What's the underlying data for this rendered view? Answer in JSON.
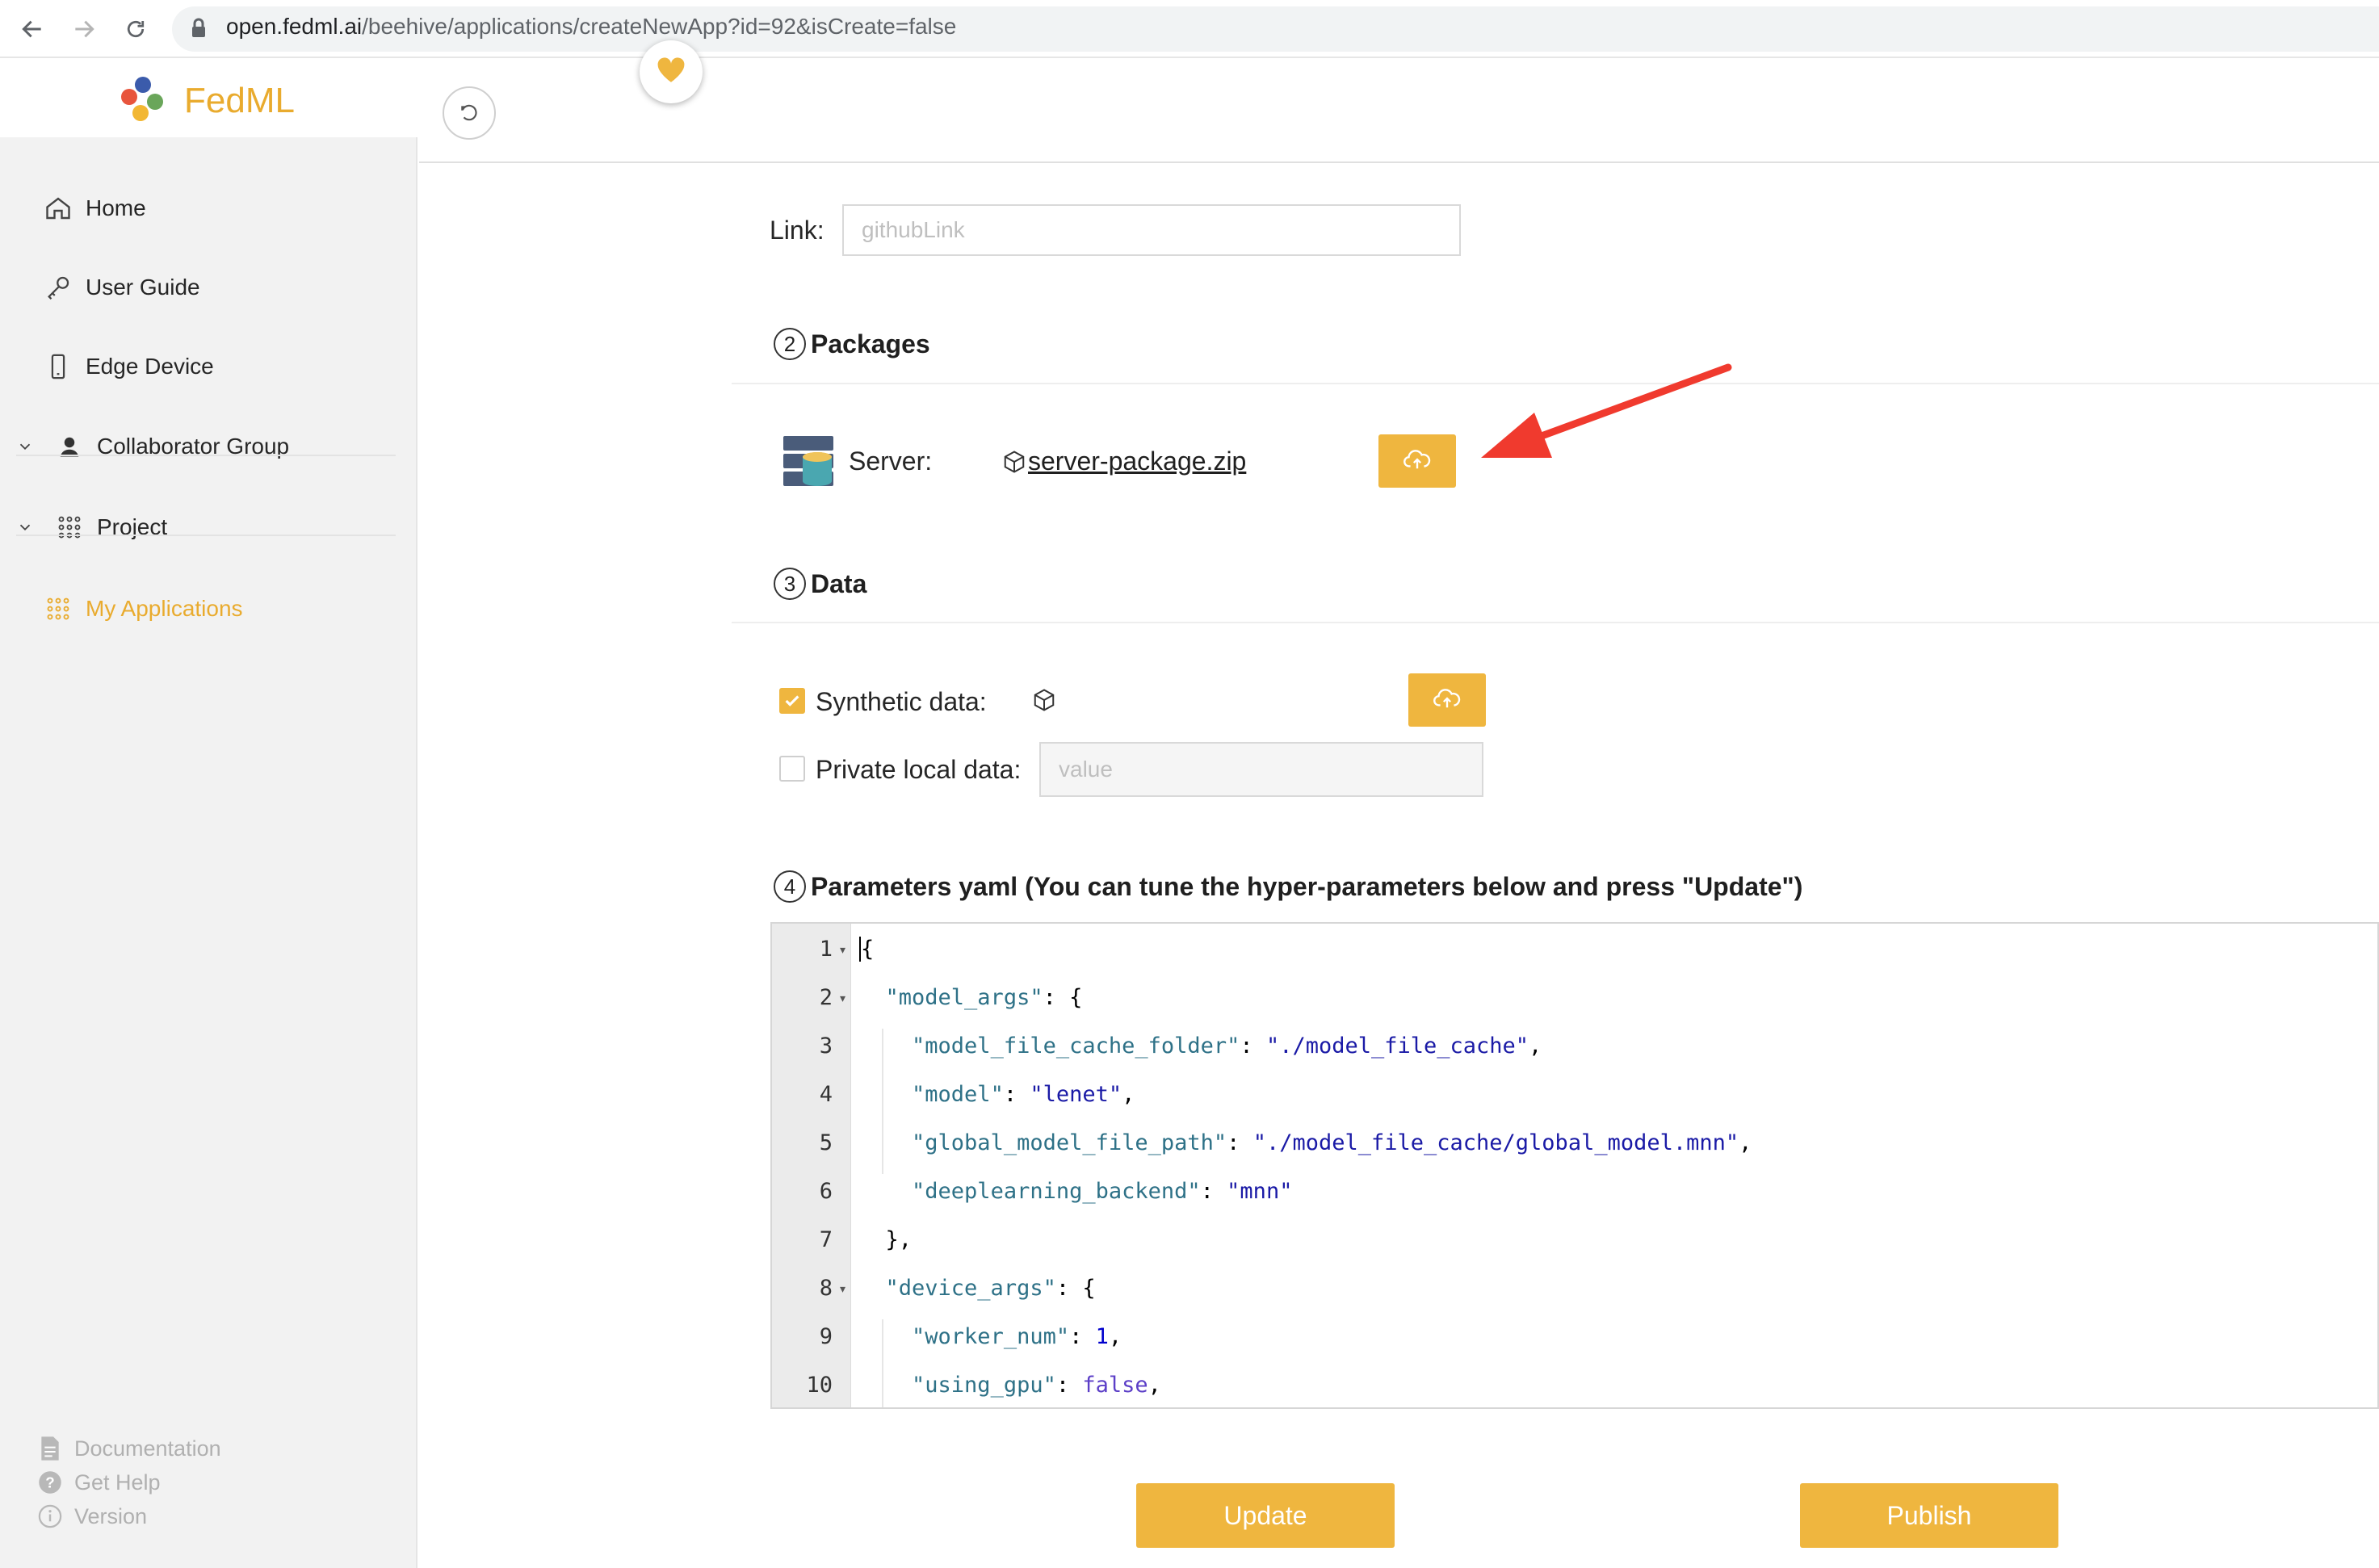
{
  "browser": {
    "url_host": "open.fedml.ai",
    "url_path": "/beehive/applications/createNewApp?id=92&isCreate=false"
  },
  "sidebar": {
    "brand": "FedML",
    "items": [
      {
        "label": "Home",
        "icon": "home-icon"
      },
      {
        "label": "User Guide",
        "icon": "key-icon"
      },
      {
        "label": "Edge Device",
        "icon": "phone-icon"
      },
      {
        "label": "Collaborator Group",
        "icon": "user-icon"
      },
      {
        "label": "Project",
        "icon": "apps-icon"
      },
      {
        "label": "My Applications",
        "icon": "apps-icon"
      }
    ],
    "footer": [
      {
        "label": "Documentation",
        "icon": "document-icon"
      },
      {
        "label": "Get Help",
        "icon": "help-icon"
      },
      {
        "label": "Version",
        "icon": "info-icon"
      }
    ]
  },
  "form": {
    "link_label": "Link:",
    "link_placeholder": "githubLink",
    "packages_number": "2",
    "packages_title": "Packages",
    "server_label": "Server:",
    "server_file": "server-package.zip",
    "data_number": "3",
    "data_title": "Data",
    "synthetic_label": "Synthetic data:",
    "synthetic_checked": true,
    "private_label": "Private local data:",
    "private_checked": false,
    "private_placeholder": "value",
    "params_number": "4",
    "params_title": "Parameters yaml (You can tune the hyper-parameters below and press \"Update\")"
  },
  "editor": {
    "line_numbers": [
      "1",
      "2",
      "3",
      "4",
      "5",
      "6",
      "7",
      "8",
      "9",
      "10"
    ]
  },
  "actions": {
    "update_label": "Update",
    "publish_label": "Publish"
  },
  "colors": {
    "accent": "#efb63f",
    "brand": "#e9ab2e",
    "arrow": "#f03a2e"
  }
}
